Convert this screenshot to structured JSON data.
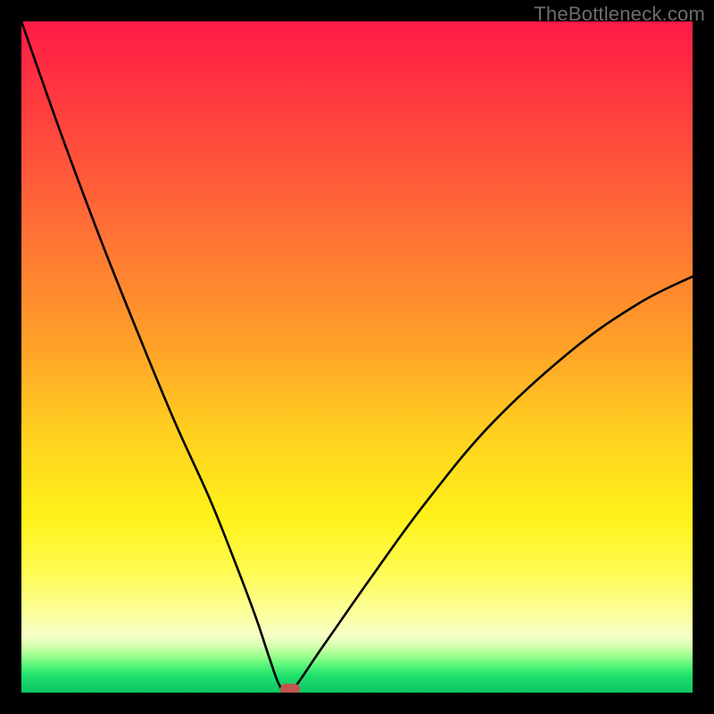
{
  "watermark": "TheBottleneck.com",
  "chart_data": {
    "type": "line",
    "title": "",
    "xlabel": "",
    "ylabel": "",
    "xlim": [
      0,
      100
    ],
    "ylim": [
      0,
      100
    ],
    "grid": false,
    "legend": false,
    "series": [
      {
        "name": "bottleneck-curve",
        "x": [
          0,
          6,
          12,
          18,
          23,
          28,
          32,
          35,
          37,
          38.5,
          40,
          45,
          52,
          60,
          70,
          82,
          92,
          100
        ],
        "y": [
          100,
          83,
          67,
          52,
          40,
          29,
          19,
          11,
          5,
          1,
          0,
          7,
          17,
          28,
          40,
          51,
          58,
          62
        ]
      }
    ],
    "marker": {
      "name": "optimal-point",
      "x": 40,
      "y": 0,
      "color": "#c1564f"
    },
    "background_gradient": {
      "direction": "vertical",
      "stops": [
        {
          "pos": 0,
          "color": "#ff1a46"
        },
        {
          "pos": 0.3,
          "color": "#ff6d36"
        },
        {
          "pos": 0.62,
          "color": "#ffd21f"
        },
        {
          "pos": 0.88,
          "color": "#fcff9a"
        },
        {
          "pos": 0.96,
          "color": "#55f57a"
        },
        {
          "pos": 1.0,
          "color": "#10c763"
        }
      ]
    }
  }
}
